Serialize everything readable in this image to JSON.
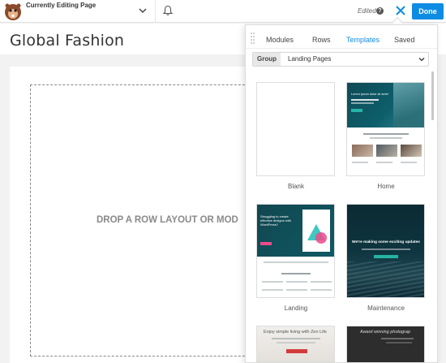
{
  "topbar": {
    "editing_label": "Currently Editing Page",
    "edited_label": "Edited",
    "help_glyph": "?",
    "done_label": "Done",
    "icons": [
      "beaver-logo-icon",
      "chevron-down-icon",
      "bell-icon",
      "help-icon",
      "close-icon"
    ]
  },
  "page": {
    "title": "Global Fashion",
    "drop_text": "DROP A ROW LAYOUT OR MOD"
  },
  "panel": {
    "tabs": [
      {
        "label": "Modules",
        "active": false
      },
      {
        "label": "Rows",
        "active": false
      },
      {
        "label": "Templates",
        "active": true
      },
      {
        "label": "Saved",
        "active": false
      }
    ],
    "group_label": "Group",
    "group_value": "Landing Pages",
    "templates": [
      {
        "label": "Blank"
      },
      {
        "label": "Home"
      },
      {
        "label": "Landing"
      },
      {
        "label": "Maintenance"
      }
    ],
    "previews": {
      "home_lorem": "Lorem ipsum dolor sit amet",
      "landing_heading": "Struggling to create effective designs with WordPress?",
      "maintenance_heading": "We're making some exciting updates",
      "simple_heading": "Enjoy simple living with Zen Life",
      "award_heading": "Award winning photograp"
    }
  },
  "colors": {
    "accent": "#0e8ce4",
    "teal": "#0f4a56"
  }
}
